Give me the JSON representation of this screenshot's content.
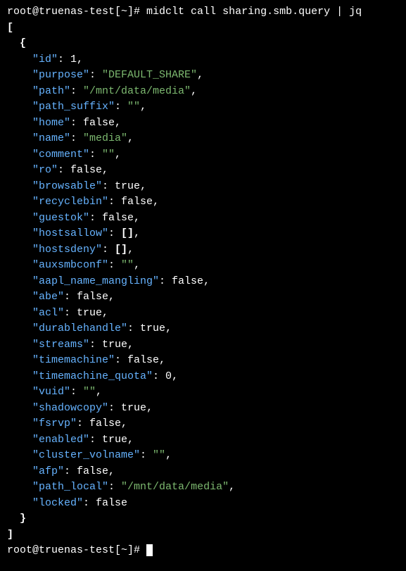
{
  "prompt1": "root@truenas-test[~]# ",
  "command": "midclt call sharing.smb.query | jq",
  "prompt2": "root@truenas-test[~]# ",
  "open_arr": "[",
  "open_obj": "{",
  "close_obj": "}",
  "close_arr": "]",
  "rows": [
    {
      "k": "\"id\"",
      "sep": ": ",
      "v": "1",
      "cls": "num",
      "c": ","
    },
    {
      "k": "\"purpose\"",
      "sep": ": ",
      "v": "\"DEFAULT_SHARE\"",
      "cls": "string",
      "c": ","
    },
    {
      "k": "\"path\"",
      "sep": ": ",
      "v": "\"/mnt/data/media\"",
      "cls": "string",
      "c": ","
    },
    {
      "k": "\"path_suffix\"",
      "sep": ": ",
      "v": "\"\"",
      "cls": "string",
      "c": ","
    },
    {
      "k": "\"home\"",
      "sep": ": ",
      "v": "false",
      "cls": "bool",
      "c": ","
    },
    {
      "k": "\"name\"",
      "sep": ": ",
      "v": "\"media\"",
      "cls": "string",
      "c": ","
    },
    {
      "k": "\"comment\"",
      "sep": ": ",
      "v": "\"\"",
      "cls": "string",
      "c": ","
    },
    {
      "k": "\"ro\"",
      "sep": ": ",
      "v": "false",
      "cls": "bool",
      "c": ","
    },
    {
      "k": "\"browsable\"",
      "sep": ": ",
      "v": "true",
      "cls": "bool",
      "c": ","
    },
    {
      "k": "\"recyclebin\"",
      "sep": ": ",
      "v": "false",
      "cls": "bool",
      "c": ","
    },
    {
      "k": "\"guestok\"",
      "sep": ": ",
      "v": "false",
      "cls": "bool",
      "c": ","
    },
    {
      "k": "\"hostsallow\"",
      "sep": ": ",
      "v": "[]",
      "cls": "bracket",
      "c": ","
    },
    {
      "k": "\"hostsdeny\"",
      "sep": ": ",
      "v": "[]",
      "cls": "bracket",
      "c": ","
    },
    {
      "k": "\"auxsmbconf\"",
      "sep": ": ",
      "v": "\"\"",
      "cls": "string",
      "c": ","
    },
    {
      "k": "\"aapl_name_mangling\"",
      "sep": ": ",
      "v": "false",
      "cls": "bool",
      "c": ","
    },
    {
      "k": "\"abe\"",
      "sep": ": ",
      "v": "false",
      "cls": "bool",
      "c": ","
    },
    {
      "k": "\"acl\"",
      "sep": ": ",
      "v": "true",
      "cls": "bool",
      "c": ","
    },
    {
      "k": "\"durablehandle\"",
      "sep": ": ",
      "v": "true",
      "cls": "bool",
      "c": ","
    },
    {
      "k": "\"streams\"",
      "sep": ": ",
      "v": "true",
      "cls": "bool",
      "c": ","
    },
    {
      "k": "\"timemachine\"",
      "sep": ": ",
      "v": "false",
      "cls": "bool",
      "c": ","
    },
    {
      "k": "\"timemachine_quota\"",
      "sep": ": ",
      "v": "0",
      "cls": "num",
      "c": ","
    },
    {
      "k": "\"vuid\"",
      "sep": ": ",
      "v": "\"\"",
      "cls": "string",
      "c": ","
    },
    {
      "k": "\"shadowcopy\"",
      "sep": ": ",
      "v": "true",
      "cls": "bool",
      "c": ","
    },
    {
      "k": "\"fsrvp\"",
      "sep": ": ",
      "v": "false",
      "cls": "bool",
      "c": ","
    },
    {
      "k": "\"enabled\"",
      "sep": ": ",
      "v": "true",
      "cls": "bool",
      "c": ","
    },
    {
      "k": "\"cluster_volname\"",
      "sep": ": ",
      "v": "\"\"",
      "cls": "string",
      "c": ","
    },
    {
      "k": "\"afp\"",
      "sep": ": ",
      "v": "false",
      "cls": "bool",
      "c": ","
    },
    {
      "k": "\"path_local\"",
      "sep": ": ",
      "v": "\"/mnt/data/media\"",
      "cls": "string",
      "c": ","
    },
    {
      "k": "\"locked\"",
      "sep": ": ",
      "v": "false",
      "cls": "bool",
      "c": ""
    }
  ]
}
